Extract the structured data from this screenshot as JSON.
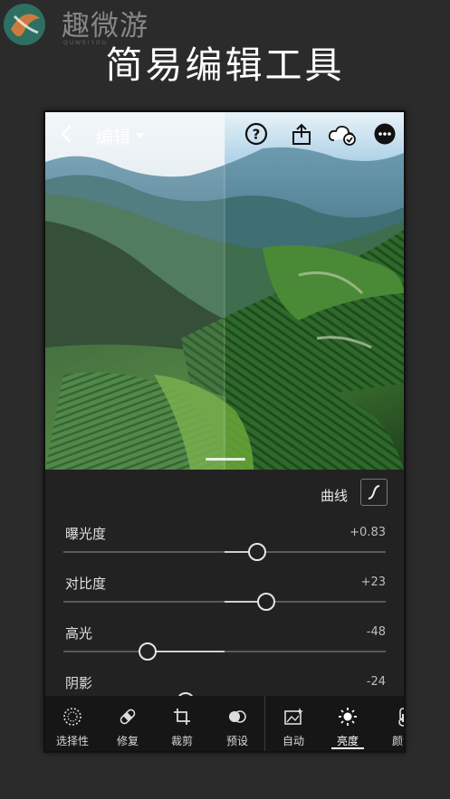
{
  "watermark": {
    "brand": "趣微游",
    "sub": "QUWEIYOU"
  },
  "headline": "简易编辑工具",
  "app": {
    "topbar": {
      "title": "编辑"
    },
    "curve": {
      "label": "曲线"
    },
    "sliders": [
      {
        "label": "曝光度",
        "value": "+0.83",
        "level": 0.6
      },
      {
        "label": "对比度",
        "value": "+23",
        "level": 0.63
      },
      {
        "label": "高光",
        "value": "-48",
        "level": 0.26
      },
      {
        "label": "阴影",
        "value": "-24",
        "level": 0.38
      }
    ],
    "toolbar": {
      "items": [
        {
          "label": "选择性",
          "icon": "selective-icon"
        },
        {
          "label": "修复",
          "icon": "bandage-icon"
        },
        {
          "label": "裁剪",
          "icon": "crop-icon"
        },
        {
          "label": "预设",
          "icon": "presets-icon"
        },
        {
          "label": "自动",
          "icon": "auto-icon"
        },
        {
          "label": "亮度",
          "icon": "sun-icon",
          "active": true
        },
        {
          "label": "颜色",
          "icon": "thermometer-icon"
        }
      ]
    }
  },
  "colors": {
    "background": "#2b2b2b",
    "panel": "#222222",
    "toolbar": "#161616",
    "text": "#ffffff"
  }
}
